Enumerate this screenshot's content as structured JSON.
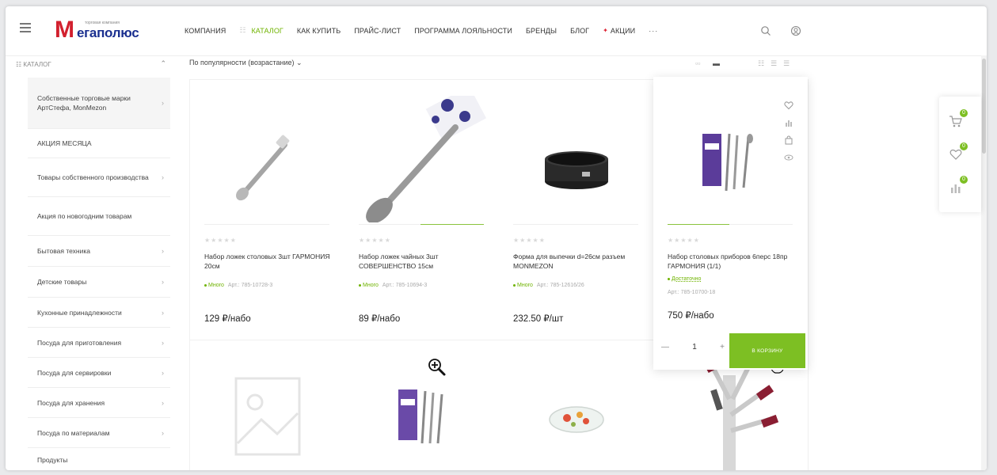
{
  "header": {
    "logo_text": "егаполюс",
    "logo_tagline": "торговая компания",
    "nav": [
      {
        "label": "Компания"
      },
      {
        "label": "Каталог"
      },
      {
        "label": "Как купить"
      },
      {
        "label": "Прайс-лист"
      },
      {
        "label": "Программа лояльности"
      },
      {
        "label": "Бренды"
      },
      {
        "label": "Блог"
      },
      {
        "label": "Акции"
      }
    ],
    "more": "···",
    "icons": [
      "search-icon",
      "user-icon"
    ],
    "accent": "#6fb300"
  },
  "catalog_header": {
    "label": "КАТАЛОГ"
  },
  "sidebar": {
    "items": [
      {
        "label": "Собственные торговые марки АртСтефа, MonMezon"
      },
      {
        "label": "АКЦИЯ МЕСЯЦА"
      },
      {
        "label": "Товары собственного производства"
      },
      {
        "label": "Акция по новогодним товарам"
      },
      {
        "label": "Бытовая техника"
      },
      {
        "label": "Детские товары"
      },
      {
        "label": "Кухонные принадлежности"
      },
      {
        "label": "Посуда для приготовления"
      },
      {
        "label": "Посуда для сервировки"
      },
      {
        "label": "Посуда для хранения"
      },
      {
        "label": "Посуда по материалам"
      },
      {
        "label": "Продукты"
      }
    ]
  },
  "sort": {
    "label": "По популярности (возрастание)"
  },
  "products": [
    {
      "name": "Набор ложек столовых 3шт ГАРМОНИЯ 20см",
      "stock": "Много",
      "article": "Арт.: 785-10728-3",
      "price": "129 ₽/набо",
      "stars": "★★★★★"
    },
    {
      "name": "Набор ложек чайных 3шт СОВЕРШЕНСТВО 15см",
      "stock": "Много",
      "article": "Арт.: 785-10694-3",
      "price": "89 ₽/набо",
      "stars": "★★★★★"
    },
    {
      "name": "Форма для выпечки d=26см разъем MONMEZON",
      "stock": "Много",
      "article": "Арт.: 785-12616/26",
      "price": "232.50 ₽/шт",
      "stars": "★★★★★"
    },
    {
      "name": "Набор столовых приборов 6перс 18пр ГАРМОНИЯ (1/1)",
      "stock": "Достаточно",
      "article": "Арт.: 785-10700-18",
      "price": "750 ₽/набо",
      "stars": "★★★★★",
      "qty": "1",
      "buy_label": "В корзину"
    }
  ],
  "qty_controls": {
    "minus": "—",
    "plus": "+"
  },
  "floating_panel": {
    "items": [
      {
        "icon": "cart-icon",
        "count": "0"
      },
      {
        "icon": "wishlist-icon",
        "count": "0"
      },
      {
        "icon": "compare-icon",
        "count": "0"
      }
    ]
  },
  "colors": {
    "green": "#7dbf23",
    "logo_red": "#d2202e",
    "logo_blue": "#1a2f8f"
  }
}
